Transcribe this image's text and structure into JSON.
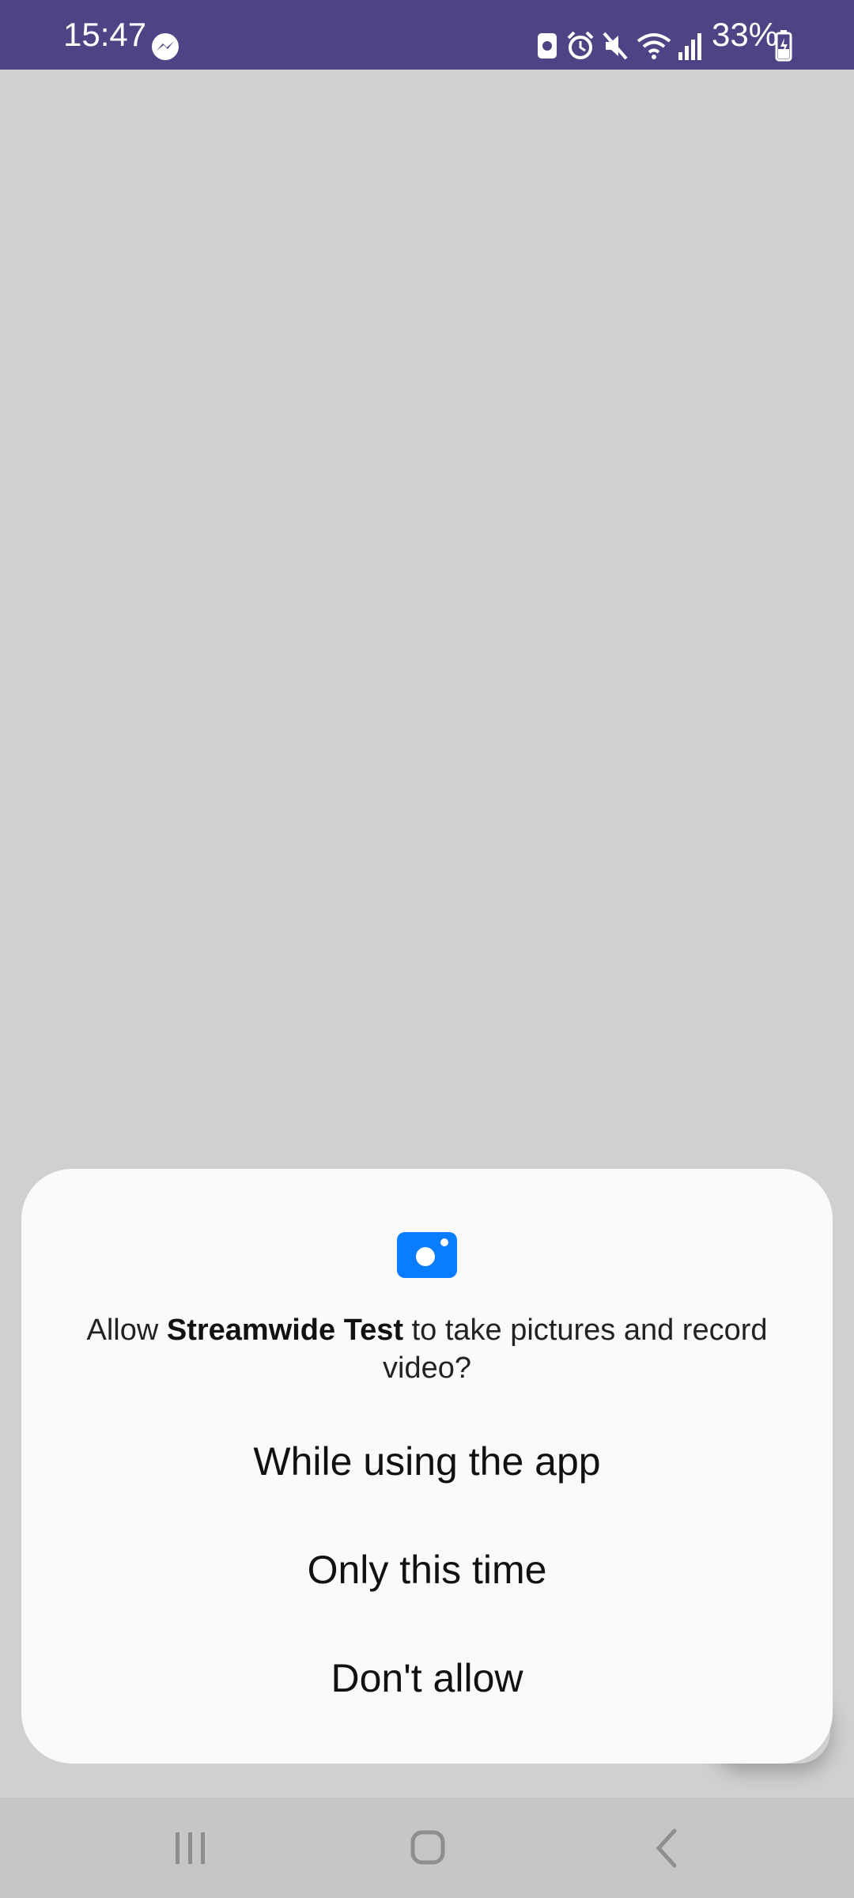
{
  "status_bar": {
    "time": "15:47",
    "battery": "33%",
    "icons": [
      "messenger-icon",
      "storage-icon",
      "alarm-icon",
      "mute-icon",
      "wifi-icon",
      "signal-icon",
      "battery-icon"
    ],
    "background": "#4f4385"
  },
  "dialog": {
    "icon": "camera-icon",
    "message_prefix": "Allow ",
    "app_name": "Streamwide Test",
    "message_suffix": " to take pictures and record video?",
    "options": [
      {
        "label": "While using the app"
      },
      {
        "label": "Only this time"
      },
      {
        "label": "Don't allow"
      }
    ],
    "accent_color": "#0a7cff"
  },
  "nav_bar": {
    "buttons": [
      "recent-apps-icon",
      "home-icon",
      "back-icon"
    ]
  }
}
